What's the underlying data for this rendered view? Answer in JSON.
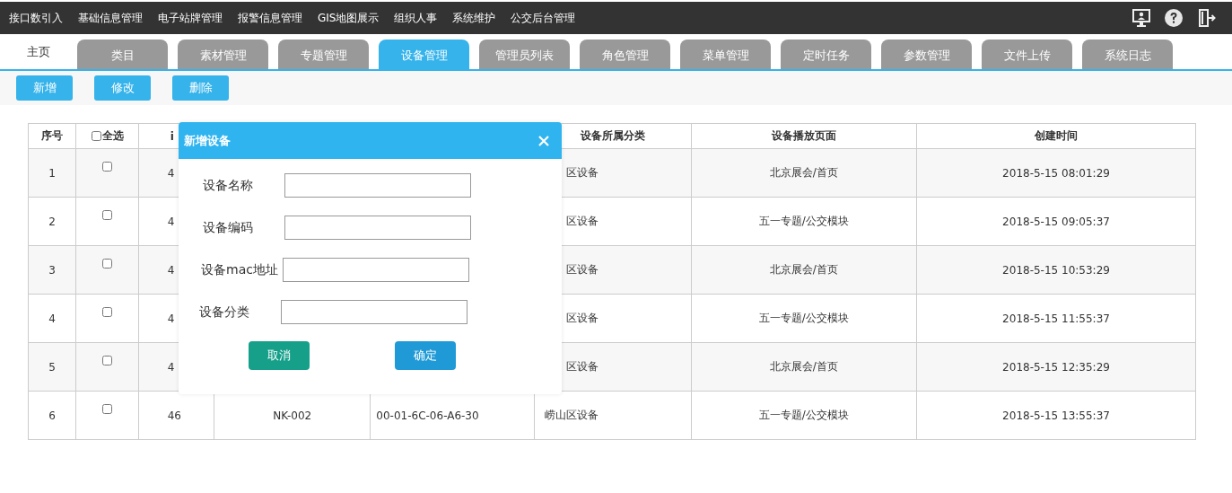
{
  "top_menu": [
    {
      "label": "接口数引入"
    },
    {
      "label": "基础信息管理"
    },
    {
      "label": "电子站牌管理"
    },
    {
      "label": "报警信息管理"
    },
    {
      "label": "GIS地图展示"
    },
    {
      "label": "组织人事"
    },
    {
      "label": "系统维护"
    },
    {
      "label": "公交后台管理"
    }
  ],
  "home_tab": {
    "label": "主页"
  },
  "tabs": [
    {
      "label": "类目",
      "selected": false
    },
    {
      "label": "素材管理",
      "selected": false
    },
    {
      "label": "专题管理",
      "selected": false
    },
    {
      "label": "设备管理",
      "selected": true
    },
    {
      "label": "管理员列表",
      "selected": false
    },
    {
      "label": "角色管理",
      "selected": false
    },
    {
      "label": "菜单管理",
      "selected": false
    },
    {
      "label": "定时任务",
      "selected": false
    },
    {
      "label": "参数管理",
      "selected": false
    },
    {
      "label": "文件上传",
      "selected": false
    },
    {
      "label": "系统日志",
      "selected": false
    }
  ],
  "actions": [
    "新增",
    "修改",
    "删除"
  ],
  "table": {
    "columns": [
      {
        "label": "序号"
      },
      {
        "label": "全选",
        "kind": "checkbox",
        "checked": false
      },
      {
        "label": "i"
      },
      {},
      {},
      {
        "label": "设备所属分类"
      },
      {
        "label": "设备播放页面"
      },
      {
        "label": "创建时间"
      }
    ],
    "rows": [
      {
        "index": "1",
        "checked": false,
        "id": "4",
        "category": "区设备",
        "page": "北京展会/首页",
        "created": "2018-5-15 08:01:29"
      },
      {
        "index": "2",
        "checked": false,
        "id": "4",
        "category": "区设备",
        "page": "五一专题/公交模块",
        "created": "2018-5-15 09:05:37"
      },
      {
        "index": "3",
        "checked": false,
        "id": "4",
        "category": "区设备",
        "page": "北京展会/首页",
        "created": "2018-5-15 10:53:29"
      },
      {
        "index": "4",
        "checked": false,
        "id": "4",
        "category": "区设备",
        "page": "五一专题/公交模块",
        "created": "2018-5-15 11:55:37"
      },
      {
        "index": "5",
        "checked": false,
        "id": "4",
        "category": "区设备",
        "page": "北京展会/首页",
        "created": "2018-5-15 12:35:29"
      },
      {
        "index": "6",
        "checked": false,
        "id": "46",
        "code": "NK-002",
        "mac": "00-01-6C-06-A6-30",
        "category": "崂山区设备",
        "page": "五一专题/公交模块",
        "created": "2018-5-15 13:55:37"
      }
    ]
  },
  "dialog": {
    "title": "新增设备",
    "fields": [
      {
        "label": "设备名称"
      },
      {
        "label": "设备编码"
      },
      {
        "label": "设备mac地址"
      },
      {
        "label": "设备分类"
      }
    ],
    "cancel": "取消",
    "confirm": "确定"
  }
}
